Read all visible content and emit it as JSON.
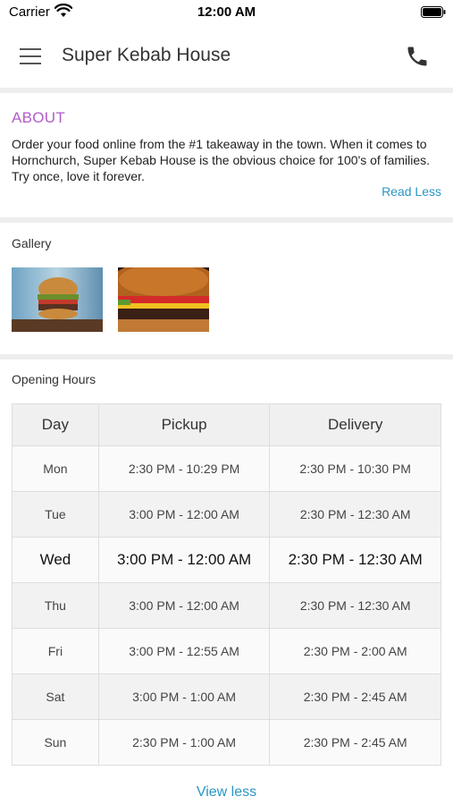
{
  "status_bar": {
    "carrier": "Carrier",
    "time": "12:00 AM"
  },
  "header": {
    "title": "Super Kebab House",
    "menu_icon": "hamburger-menu-icon",
    "phone_icon": "phone-icon"
  },
  "about": {
    "heading": "ABOUT",
    "text": "Order your food online from the #1 takeaway in the town. When it comes to Hornchurch, Super Kebab House is the obvious choice for 100's of families. Try once, love it forever.",
    "read_less": "Read Less"
  },
  "gallery": {
    "heading": "Gallery",
    "images": [
      "burger-photo",
      "cheeseburger-closeup-photo"
    ]
  },
  "opening_hours": {
    "heading": "Opening Hours",
    "columns": [
      "Day",
      "Pickup",
      "Delivery"
    ],
    "rows": [
      {
        "day": "Mon",
        "pickup": "2:30 PM - 10:29 PM",
        "delivery": "2:30 PM - 10:30 PM"
      },
      {
        "day": "Tue",
        "pickup": "3:00 PM - 12:00 AM",
        "delivery": "2:30 PM - 12:30 AM"
      },
      {
        "day": "Wed",
        "pickup": "3:00 PM - 12:00 AM",
        "delivery": "2:30 PM - 12:30 AM"
      },
      {
        "day": "Thu",
        "pickup": "3:00 PM - 12:00 AM",
        "delivery": "2:30 PM - 12:30 AM"
      },
      {
        "day": "Fri",
        "pickup": "3:00 PM - 12:55 AM",
        "delivery": "2:30 PM - 2:00 AM"
      },
      {
        "day": "Sat",
        "pickup": "3:00 PM - 1:00 AM",
        "delivery": "2:30 PM - 2:45 AM"
      },
      {
        "day": "Sun",
        "pickup": "2:30 PM - 1:00 AM",
        "delivery": "2:30 PM - 2:45 AM"
      }
    ],
    "view_less": "View less"
  },
  "colors": {
    "about_heading": "#b35cc9",
    "link": "#2a96c2"
  }
}
